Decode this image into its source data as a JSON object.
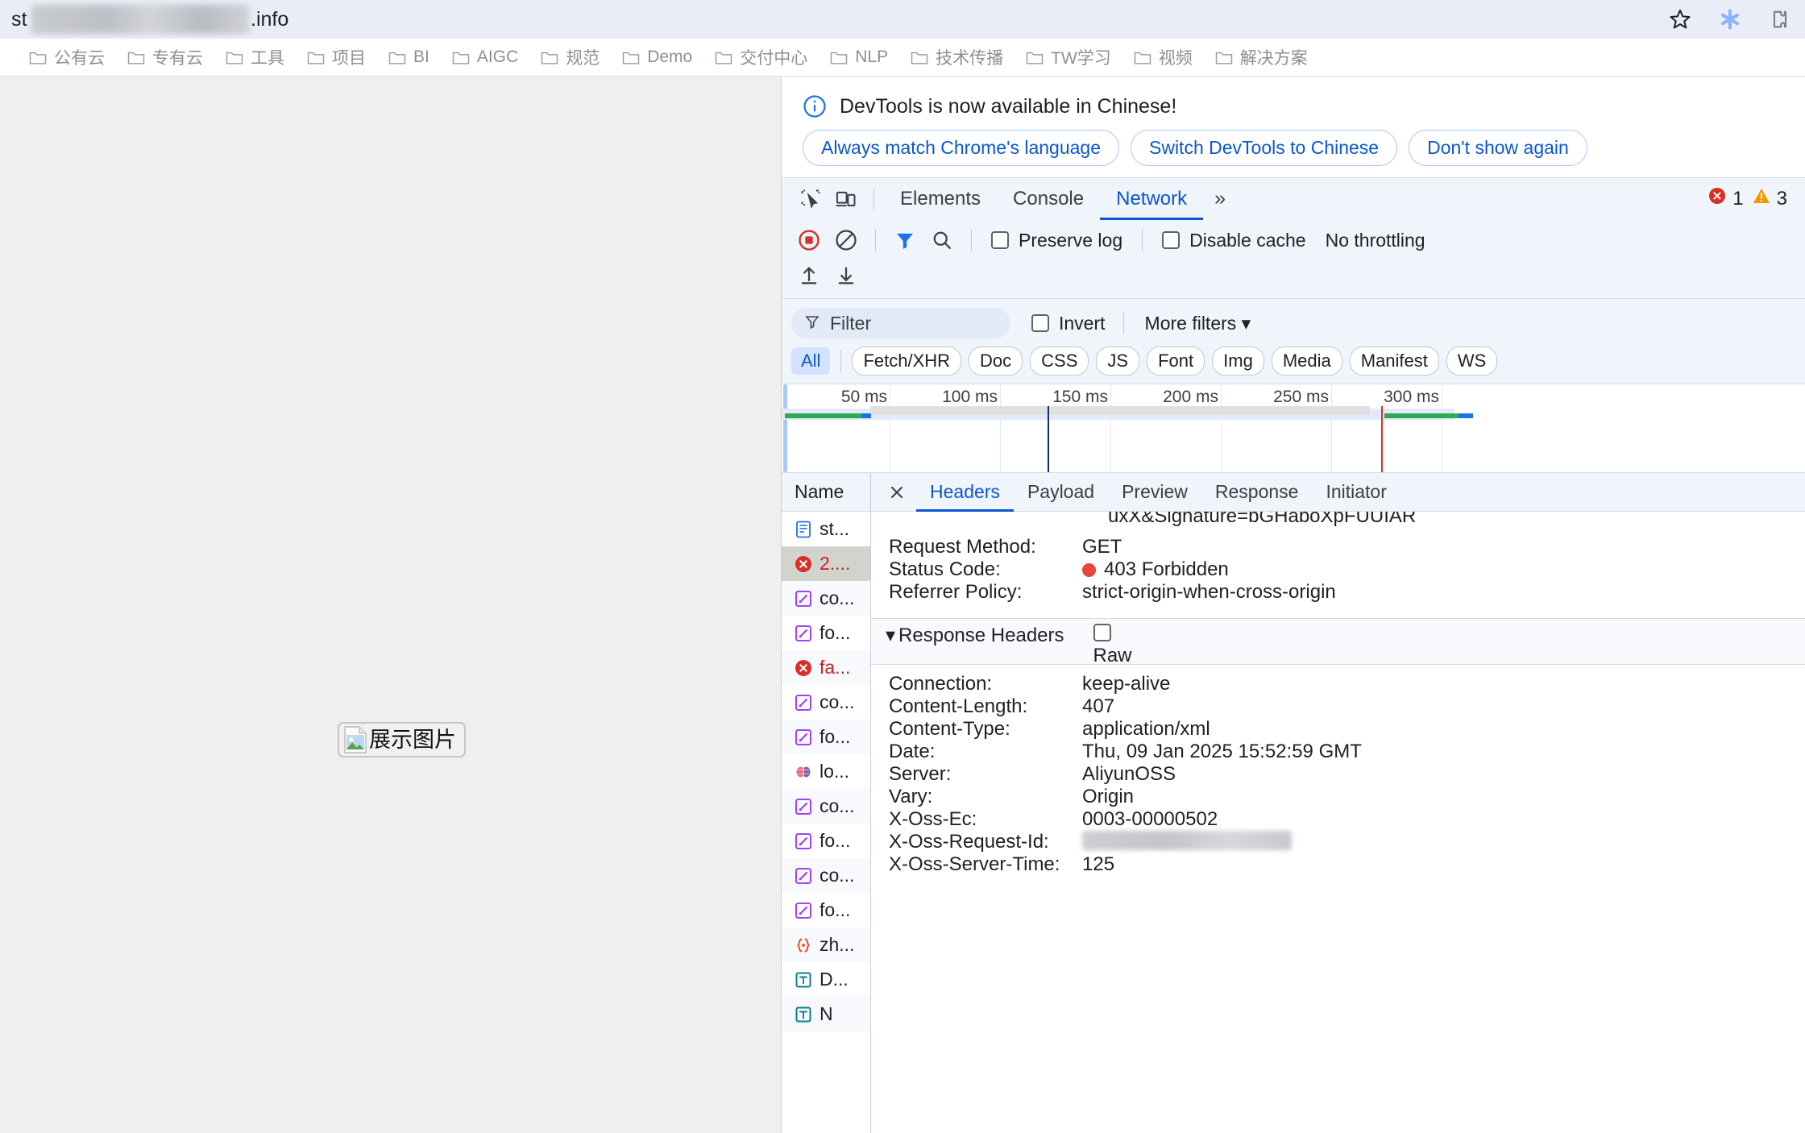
{
  "browser": {
    "url_prefix": "st",
    "url_suffix": ".info",
    "icons": {
      "bookmark": "star-icon",
      "extension_blue": "blue-asterisk-icon",
      "extensions": "extensions-puzzle-icon"
    },
    "bookmarks": [
      {
        "label": "公有云"
      },
      {
        "label": "专有云"
      },
      {
        "label": "工具"
      },
      {
        "label": "项目"
      },
      {
        "label": "BI"
      },
      {
        "label": "AIGC"
      },
      {
        "label": "规范"
      },
      {
        "label": "Demo"
      },
      {
        "label": "交付中心"
      },
      {
        "label": "NLP"
      },
      {
        "label": "技术传播"
      },
      {
        "label": "TW学习"
      },
      {
        "label": "视频"
      },
      {
        "label": "解决方案"
      }
    ]
  },
  "page": {
    "broken_image_alt": "展示图片"
  },
  "devtools": {
    "banner": {
      "message": "DevTools is now available in Chinese!",
      "buttons": [
        {
          "label": "Always match Chrome's language"
        },
        {
          "label": "Switch DevTools to Chinese"
        },
        {
          "label": "Don't show again"
        }
      ]
    },
    "tabs": [
      {
        "label": "Elements",
        "active": false
      },
      {
        "label": "Console",
        "active": false
      },
      {
        "label": "Network",
        "active": true
      }
    ],
    "more_tabs_glyph": "»",
    "counts": {
      "errors": "1",
      "warnings": "3"
    },
    "network_toolbar": {
      "preserve_log": "Preserve log",
      "disable_cache": "Disable cache",
      "throttling": "No throttling"
    },
    "filter": {
      "placeholder": "Filter",
      "invert": "Invert",
      "more_filters": "More filters",
      "types": [
        "All",
        "Fetch/XHR",
        "Doc",
        "CSS",
        "JS",
        "Font",
        "Img",
        "Media",
        "Manifest",
        "WS"
      ]
    },
    "overview": {
      "ticks": [
        "50 ms",
        "100 ms",
        "150 ms",
        "200 ms",
        "250 ms",
        "300 ms"
      ]
    },
    "request_list": {
      "header": "Name",
      "rows": [
        {
          "name": "st...",
          "icon": "doc-icon",
          "state": "normal",
          "selected": false
        },
        {
          "name": "2....",
          "icon": "error-icon",
          "state": "error",
          "selected": true
        },
        {
          "name": "co...",
          "icon": "script-icon",
          "state": "normal",
          "selected": false
        },
        {
          "name": "fo...",
          "icon": "script-icon",
          "state": "normal",
          "selected": false
        },
        {
          "name": "fa...",
          "icon": "error-icon",
          "state": "error",
          "selected": false
        },
        {
          "name": "co...",
          "icon": "script-icon",
          "state": "normal",
          "selected": false
        },
        {
          "name": "fo...",
          "icon": "script-icon",
          "state": "normal",
          "selected": false
        },
        {
          "name": "lo...",
          "icon": "wasm-icon",
          "state": "normal",
          "selected": false
        },
        {
          "name": "co...",
          "icon": "script-icon",
          "state": "normal",
          "selected": false
        },
        {
          "name": "fo...",
          "icon": "script-icon",
          "state": "normal",
          "selected": false
        },
        {
          "name": "co...",
          "icon": "script-icon",
          "state": "normal",
          "selected": false
        },
        {
          "name": "fo...",
          "icon": "script-icon",
          "state": "normal",
          "selected": false
        },
        {
          "name": "zh...",
          "icon": "json-icon",
          "state": "normal",
          "selected": false
        },
        {
          "name": "D...",
          "icon": "text-icon",
          "state": "normal",
          "selected": false
        },
        {
          "name": "N",
          "icon": "text-icon",
          "state": "normal",
          "selected": false
        }
      ]
    },
    "detail_tabs": [
      {
        "label": "Headers",
        "active": true
      },
      {
        "label": "Payload",
        "active": false
      },
      {
        "label": "Preview",
        "active": false
      },
      {
        "label": "Response",
        "active": false
      },
      {
        "label": "Initiator",
        "active": false
      }
    ],
    "headers": {
      "clipped_url_fragment": "uxX&Signature=bGHaboXpFUUIAR",
      "general": [
        {
          "key": "Request Method:",
          "value": "GET"
        },
        {
          "key": "Status Code:",
          "value": "403 Forbidden",
          "dot": "#e8453c"
        },
        {
          "key": "Referrer Policy:",
          "value": "strict-origin-when-cross-origin"
        }
      ],
      "response_section_title": "Response Headers",
      "raw_label": "Raw",
      "response": [
        {
          "key": "Connection:",
          "value": "keep-alive"
        },
        {
          "key": "Content-Length:",
          "value": "407"
        },
        {
          "key": "Content-Type:",
          "value": "application/xml"
        },
        {
          "key": "Date:",
          "value": "Thu, 09 Jan 2025 15:52:59 GMT"
        },
        {
          "key": "Server:",
          "value": "AliyunOSS"
        },
        {
          "key": "Vary:",
          "value": "Origin"
        },
        {
          "key": "X-Oss-Ec:",
          "value": "0003-00000502"
        },
        {
          "key": "X-Oss-Request-Id:",
          "value": "",
          "redacted": true
        },
        {
          "key": "X-Oss-Server-Time:",
          "value": "125"
        }
      ]
    }
  },
  "colors": {
    "accent": "#0b57d0",
    "error": "#e8453c",
    "warning": "#f29900",
    "omnibar_bg": "#e8edf7",
    "devtools_bg": "#f0f4fb"
  }
}
